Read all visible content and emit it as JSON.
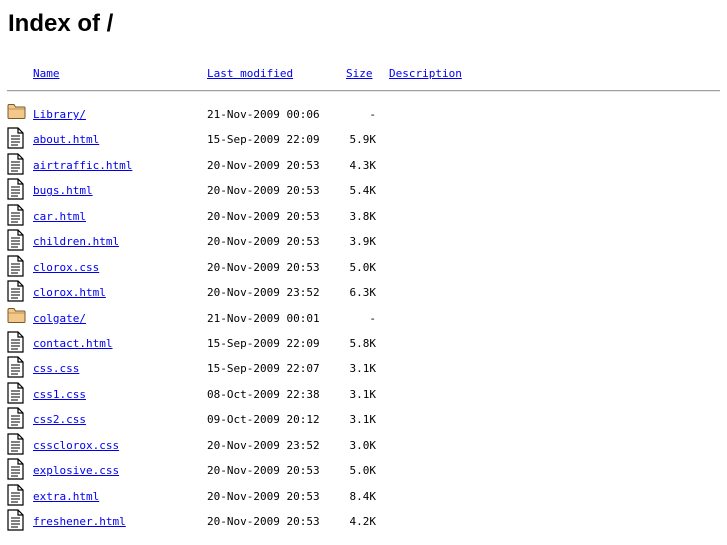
{
  "page": {
    "title": "Index of /"
  },
  "columns": {
    "name": "Name",
    "last_modified": "Last modified",
    "size": "Size",
    "description": "Description"
  },
  "icons": {
    "folder": "folder-icon",
    "file": "text-file-icon"
  },
  "colors": {
    "link": "#0000ee",
    "folder_fill": "#f2c98a",
    "folder_stroke": "#7a5a2a"
  },
  "entries": [
    {
      "type": "folder",
      "name": "Library/",
      "modified": "21-Nov-2009 00:06",
      "size": "-",
      "description": ""
    },
    {
      "type": "file",
      "name": "about.html",
      "modified": "15-Sep-2009 22:09",
      "size": "5.9K",
      "description": ""
    },
    {
      "type": "file",
      "name": "airtraffic.html",
      "modified": "20-Nov-2009 20:53",
      "size": "4.3K",
      "description": ""
    },
    {
      "type": "file",
      "name": "bugs.html",
      "modified": "20-Nov-2009 20:53",
      "size": "5.4K",
      "description": ""
    },
    {
      "type": "file",
      "name": "car.html",
      "modified": "20-Nov-2009 20:53",
      "size": "3.8K",
      "description": ""
    },
    {
      "type": "file",
      "name": "children.html",
      "modified": "20-Nov-2009 20:53",
      "size": "3.9K",
      "description": ""
    },
    {
      "type": "file",
      "name": "clorox.css",
      "modified": "20-Nov-2009 20:53",
      "size": "5.0K",
      "description": ""
    },
    {
      "type": "file",
      "name": "clorox.html",
      "modified": "20-Nov-2009 23:52",
      "size": "6.3K",
      "description": ""
    },
    {
      "type": "folder",
      "name": "colgate/",
      "modified": "21-Nov-2009 00:01",
      "size": "-",
      "description": ""
    },
    {
      "type": "file",
      "name": "contact.html",
      "modified": "15-Sep-2009 22:09",
      "size": "5.8K",
      "description": ""
    },
    {
      "type": "file",
      "name": "css.css",
      "modified": "15-Sep-2009 22:07",
      "size": "3.1K",
      "description": ""
    },
    {
      "type": "file",
      "name": "css1.css",
      "modified": "08-Oct-2009 22:38",
      "size": "3.1K",
      "description": ""
    },
    {
      "type": "file",
      "name": "css2.css",
      "modified": "09-Oct-2009 20:12",
      "size": "3.1K",
      "description": ""
    },
    {
      "type": "file",
      "name": "cssclorox.css",
      "modified": "20-Nov-2009 23:52",
      "size": "3.0K",
      "description": ""
    },
    {
      "type": "file",
      "name": "explosive.css",
      "modified": "20-Nov-2009 20:53",
      "size": "5.0K",
      "description": ""
    },
    {
      "type": "file",
      "name": "extra.html",
      "modified": "20-Nov-2009 20:53",
      "size": "8.4K",
      "description": ""
    },
    {
      "type": "file",
      "name": "freshener.html",
      "modified": "20-Nov-2009 20:53",
      "size": "4.2K",
      "description": ""
    }
  ]
}
